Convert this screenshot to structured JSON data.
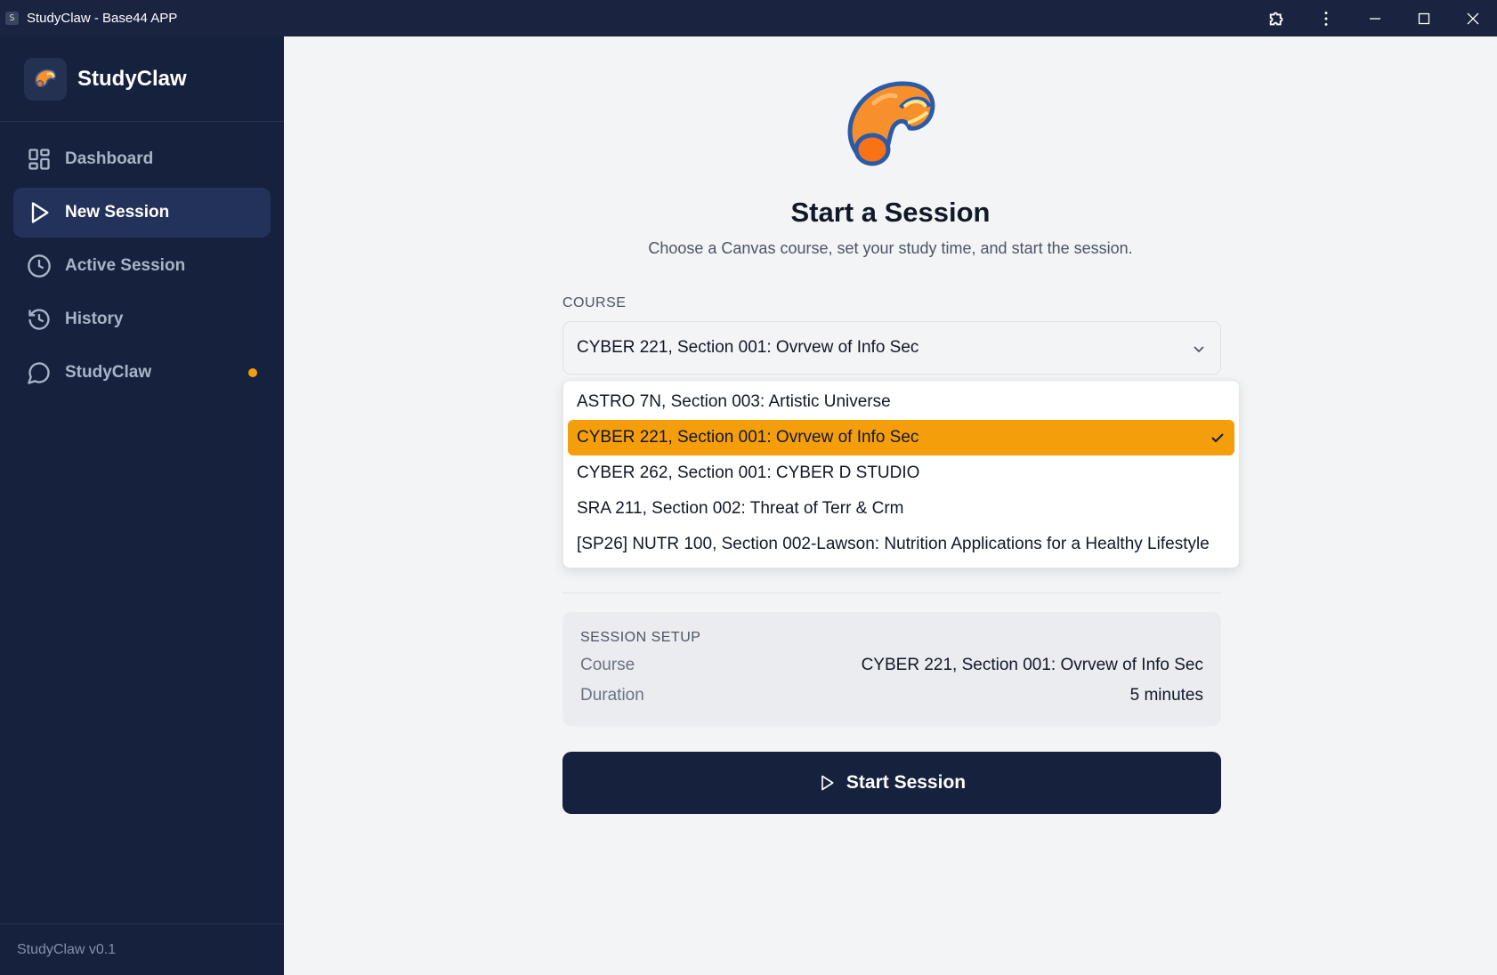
{
  "window": {
    "app_icon_letter": "S",
    "title": "StudyClaw - Base44 APP"
  },
  "sidebar": {
    "brand": "StudyClaw",
    "items": [
      {
        "label": "Dashboard",
        "icon": "grid-icon",
        "active": false
      },
      {
        "label": "New Session",
        "icon": "play-icon",
        "active": true
      },
      {
        "label": "Active Session",
        "icon": "clock-icon",
        "active": false
      },
      {
        "label": "History",
        "icon": "history-icon",
        "active": false
      },
      {
        "label": "StudyClaw",
        "icon": "chat-icon",
        "active": false,
        "badge_dot": true
      }
    ],
    "footer": "StudyClaw v0.1"
  },
  "main": {
    "title": "Start a Session",
    "subtitle": "Choose a Canvas course, set your study time, and start the session.",
    "course_label": "COURSE",
    "selected_course": "CYBER 221, Section 001: Ovrvew of Info Sec",
    "options": [
      "ASTRO 7N, Section 003: Artistic Universe",
      "CYBER 221, Section 001: Ovrvew of Info Sec",
      "CYBER 262, Section 001: CYBER D STUDIO",
      "SRA 211, Section 002: Threat of Terr & Crm",
      "[SP26] NUTR 100, Section 002-Lawson: Nutrition Applications for a Healthy Lifestyle"
    ],
    "selected_index": 1,
    "setup": {
      "title": "SESSION SETUP",
      "course_key": "Course",
      "course_value": "CYBER 221, Section 001: Ovrvew of Info Sec",
      "duration_key": "Duration",
      "duration_value": "5 minutes"
    },
    "start_button": "Start Session"
  },
  "colors": {
    "sidebar_bg": "#15213d",
    "accent": "#f59e0b",
    "main_bg": "#f3f4f6"
  }
}
